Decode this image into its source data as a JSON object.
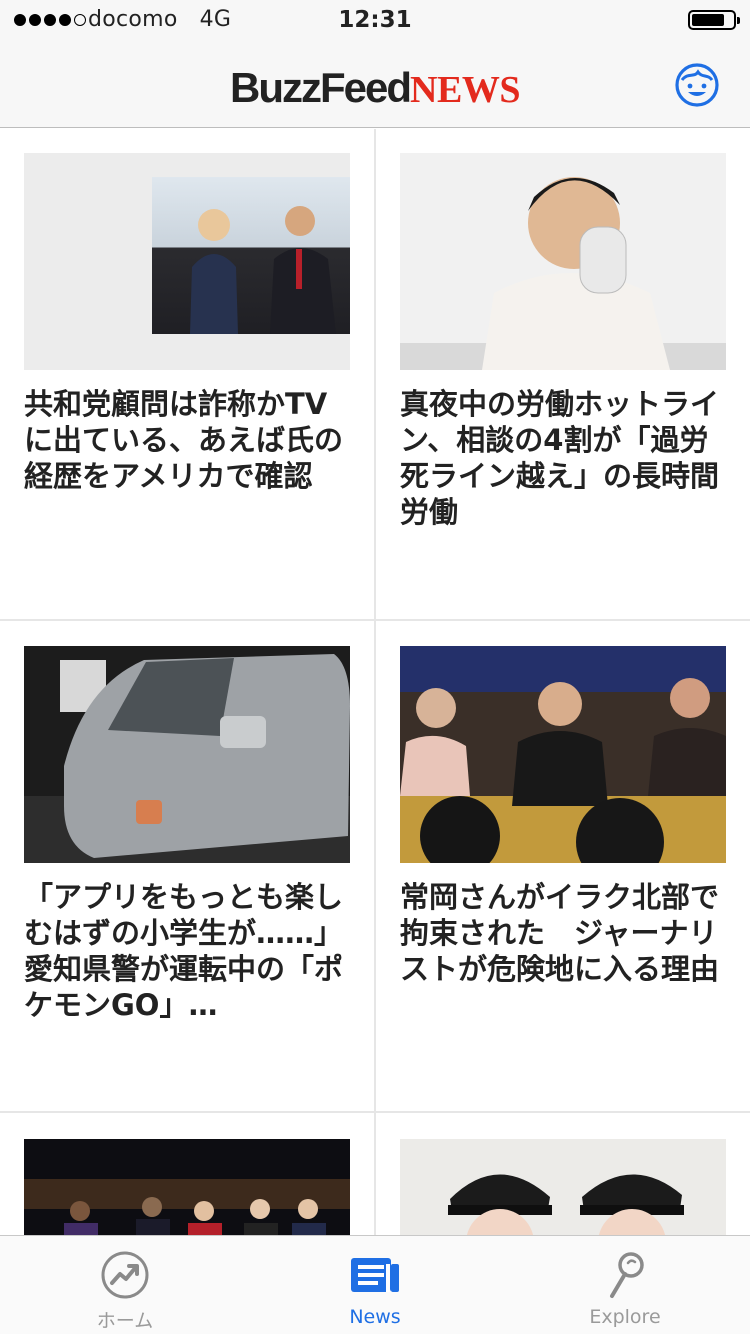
{
  "status_bar": {
    "carrier": "docomo",
    "network": "4G",
    "time": "12:31"
  },
  "header": {
    "logo_buzzfeed": "BuzzFeed",
    "logo_news": "NEWS",
    "brand_color": "#e32a1d",
    "profile_icon": "face-icon"
  },
  "feed": {
    "articles": [
      {
        "headline": "共和党顧問は詐称かTVに出ている、あえば氏の経歴をアメリカで確認",
        "image": "two-people-seated-photo"
      },
      {
        "headline": "真夜中の労働ホットライン、相談の4割が「過労死ライン越え」の長時間労働",
        "image": "man-on-phone-photo"
      },
      {
        "headline": "「アプリをもっとも楽しむはずの小学生が……」 愛知県警が運転中の「ポケモンGO」…",
        "image": "damaged-van-photo"
      },
      {
        "headline": "常岡さんがイラク北部で拘束された　ジャーナリストが危険地に入る理由",
        "image": "press-conference-photo"
      },
      {
        "headline": "",
        "image": "stage-crowd-photo"
      },
      {
        "headline": "",
        "image": "two-conductors-photo"
      }
    ]
  },
  "tab_bar": {
    "tabs": [
      {
        "label": "ホーム",
        "icon": "trending-icon",
        "active": false
      },
      {
        "label": "News",
        "icon": "news-icon",
        "active": true
      },
      {
        "label": "Explore",
        "icon": "search-icon",
        "active": false
      }
    ],
    "active_color": "#1f6fe4",
    "inactive_color": "#9a9a9a"
  }
}
